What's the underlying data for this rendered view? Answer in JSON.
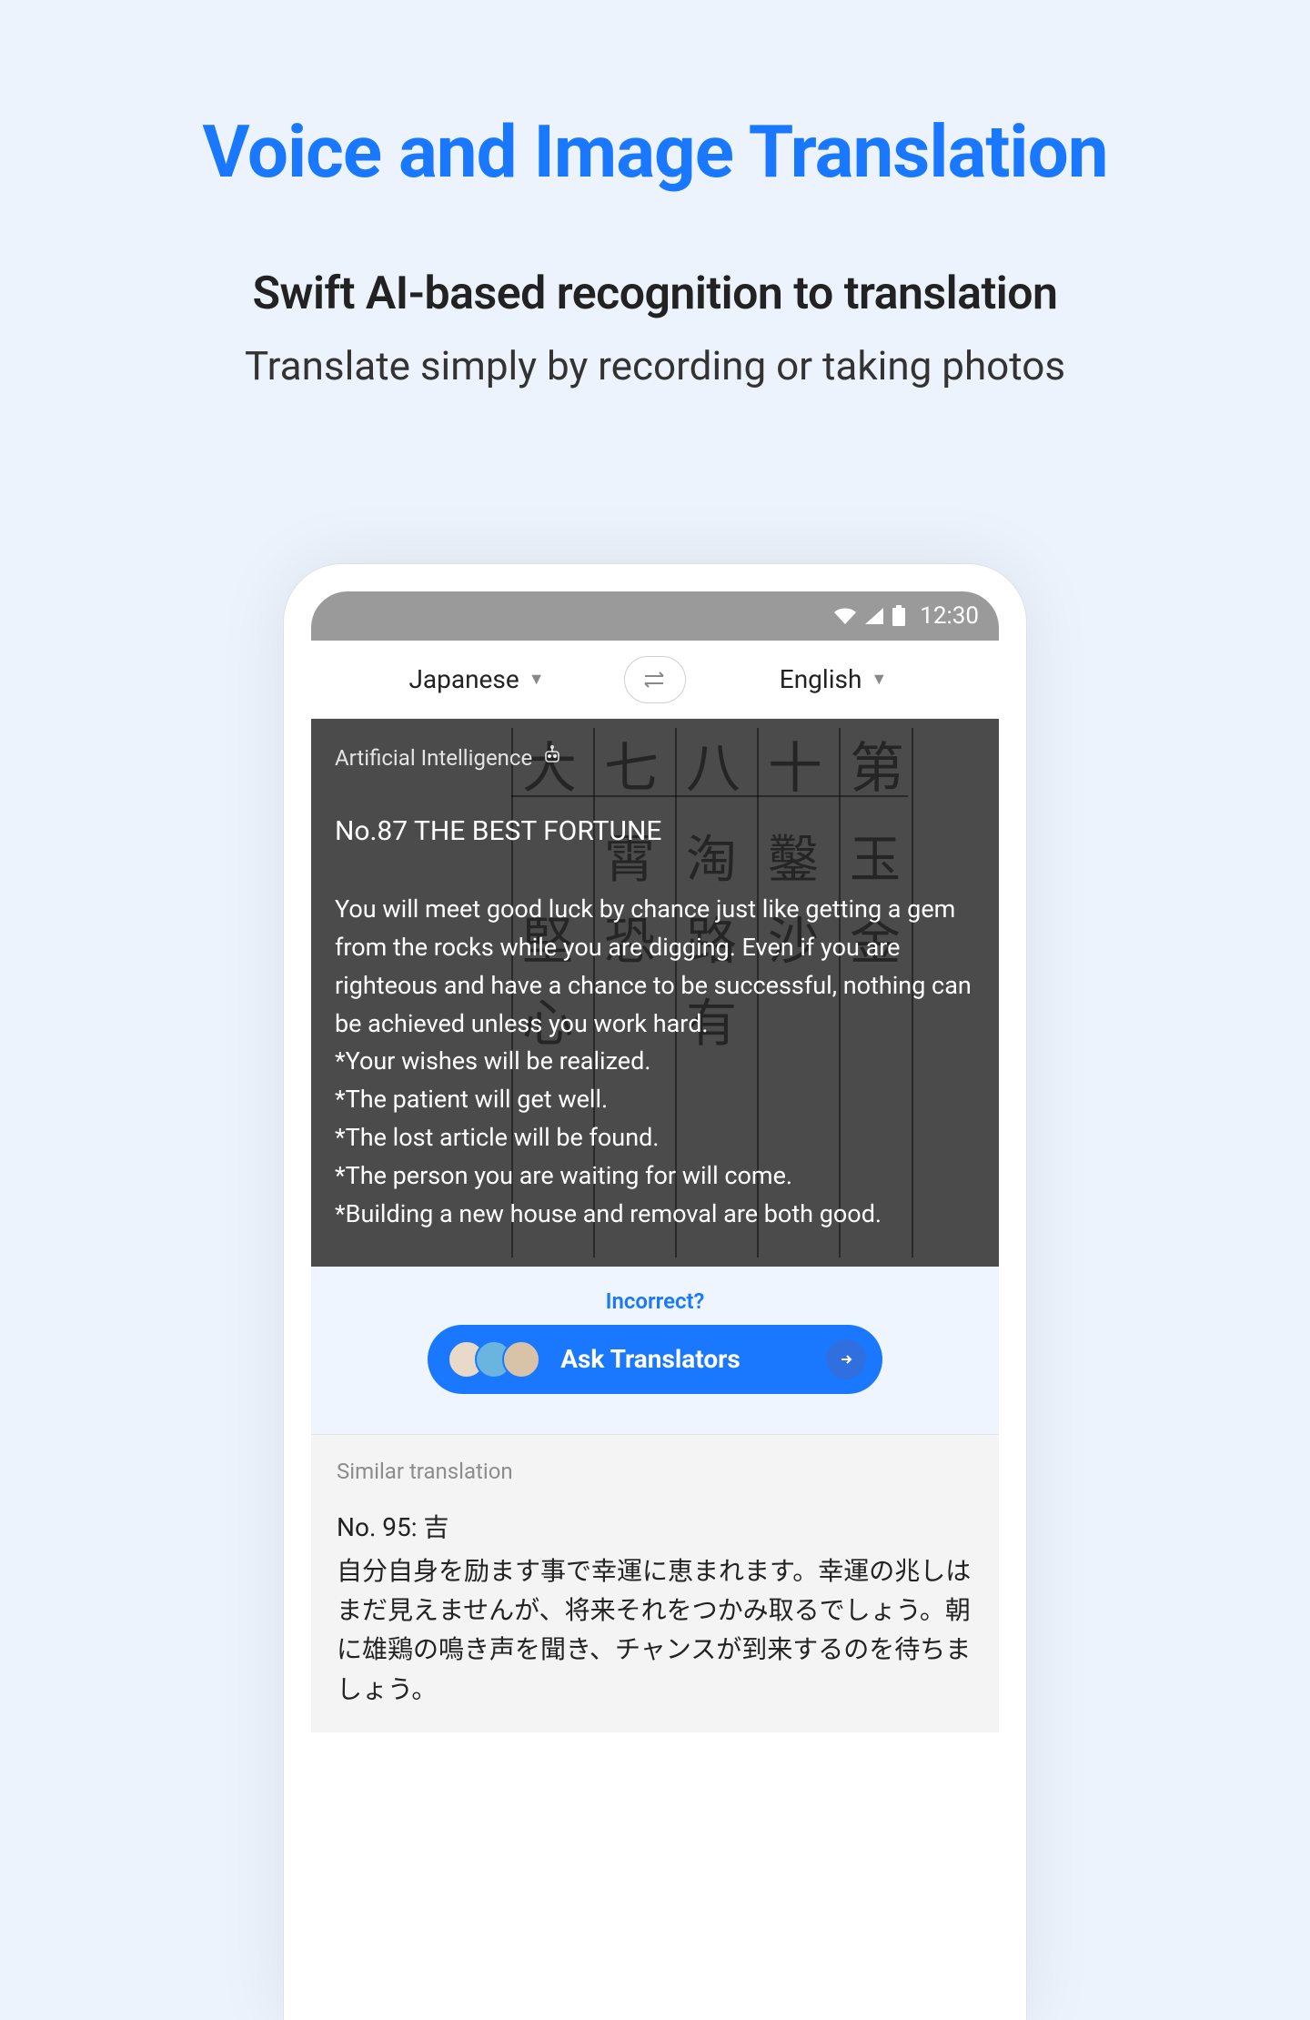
{
  "promo": {
    "title": "Voice and Image Translation",
    "subhead": "Swift AI-based recognition to translation",
    "subhead2": "Translate simply by recording or taking photos"
  },
  "statusbar": {
    "time": "12:30"
  },
  "langbar": {
    "source": "Japanese",
    "target": "English"
  },
  "result": {
    "ai_label": "Artificial Intelligence",
    "title": "No.87 THE BEST FORTUNE",
    "body": "You will meet good luck by chance just like getting a gem from the rocks while you are digging. Even if you are righteous and have a chance to be successful, nothing can be achieved unless you work hard.\n*Your wishes will be realized.\n*The patient will get well.\n*The lost article will be found.\n*The person you are waiting for will come.\n*Building a new house and removal are both good.",
    "bg_chars": [
      "第",
      "十",
      "八",
      "七",
      "大",
      "玉",
      "鑿",
      "金",
      "沙",
      "淘",
      "路",
      "有",
      "恐",
      "霄",
      "心",
      "堅"
    ]
  },
  "feedback": {
    "incorrect_label": "Incorrect?",
    "ask_label": "Ask Translators"
  },
  "similar": {
    "label": "Similar translation",
    "title": "No. 95: 吉",
    "body": "自分自身を励ます事で幸運に恵まれます。幸運の兆しはまだ見えませんが、将来それをつかみ取るでしょう。朝に雄鶏の鳴き声を聞き、チャンスが到来するのを待ちましょう。"
  }
}
